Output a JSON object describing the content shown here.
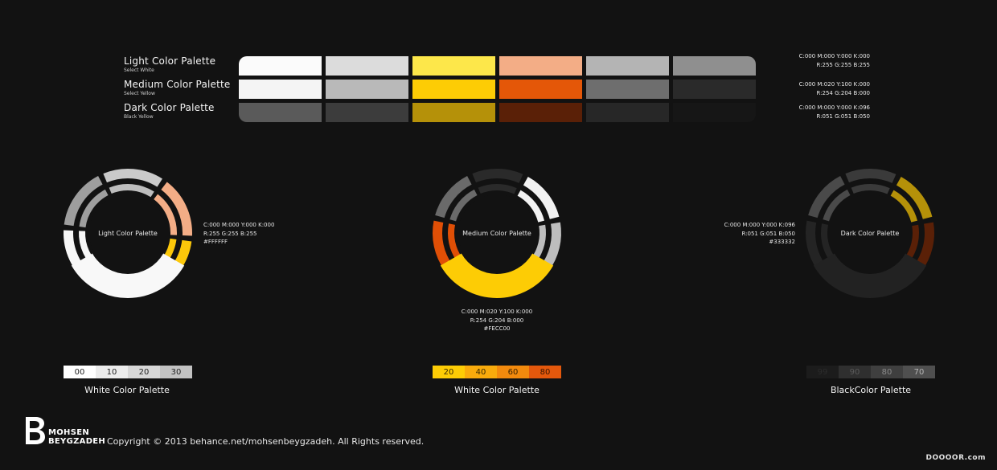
{
  "palettes": [
    {
      "title": "Light Color Palette",
      "subtitle": "Select White",
      "colors": [
        "#fbfbfb",
        "#dcdcdc",
        "#fde74a",
        "#f3ad86",
        "#b4b4b4",
        "#8f8f8f"
      ],
      "cmyk": "C:000  M:000  Y:000  K:000",
      "rgb": "R:255  G:255  B:255"
    },
    {
      "title": "Medium Color Palette",
      "subtitle": "Select Yellow",
      "colors": [
        "#f4f4f4",
        "#b9b9b9",
        "#fdcc05",
        "#e45708",
        "#6e6e6e",
        "#2a2a2a"
      ],
      "cmyk": "C:000  M:020  Y:100  K:000",
      "rgb": "R:254  G:204  B:000"
    },
    {
      "title": "Dark Color Palette",
      "subtitle": "Black Yellow",
      "colors": [
        "#5a5a5a",
        "#3c3c3c",
        "#b59109",
        "#5a2007",
        "#272727",
        "#161616"
      ],
      "cmyk": "C:000  M:000  Y:000  K:096",
      "rgb": "R:051  G:051  B:050"
    }
  ],
  "wheels": [
    {
      "label": "Light Color Palette",
      "info": [
        "C:000  M:000  Y:000  K:000",
        "R:255  G:255  B:255",
        "#FFFFFF"
      ],
      "outer_colors": [
        "#cacaca",
        "#f3ad86",
        "#fcc80a",
        "#f7f7f7",
        "#f7f7f7",
        "#9e9e9e"
      ],
      "inner_colors": [
        "#bdbdbd",
        "#f3ad86",
        "#fcc80a",
        "#f7f7f7",
        "#f7f7f7",
        "#9e9e9e"
      ]
    },
    {
      "label": "Medium Color Palette",
      "info": [
        "C:000  M:020  Y:100  K:000",
        "R:254  G:204  B:000",
        "#FECC00"
      ],
      "outer_colors": [
        "#2a2a2a",
        "#f2f2f2",
        "#bdbdbd",
        "#fdcc05",
        "#fdcc05",
        "#e04f06",
        "#6a6a6a"
      ],
      "inner_colors": [
        "#2a2a2a",
        "#f2f2f2",
        "#bdbdbd",
        "#fdcc05",
        "#fdcc05",
        "#e04f06",
        "#6a6a6a"
      ]
    },
    {
      "label": "Dark Color Palette",
      "info": [
        "C:000  M:000  Y:000  K:096",
        "R:051  G:051  B:050",
        "#333332"
      ],
      "outer_colors": [
        "#3a3a3a",
        "#b59109",
        "#5a2007",
        "#2a2a2a",
        "#242424",
        "#242424",
        "#4a4a4a"
      ],
      "inner_colors": [
        "#3a3a3a",
        "#b59109",
        "#5a2007",
        "#2a2a2a",
        "#242424",
        "#242424",
        "#4a4a4a"
      ]
    }
  ],
  "scales": [
    {
      "caption": "White Color Palette",
      "cells": [
        {
          "label": "00",
          "bg": "#ffffff",
          "fg": "#222222"
        },
        {
          "label": "10",
          "bg": "#ececec",
          "fg": "#222222"
        },
        {
          "label": "20",
          "bg": "#d7d7d7",
          "fg": "#222222"
        },
        {
          "label": "30",
          "bg": "#c2c2c2",
          "fg": "#222222"
        }
      ]
    },
    {
      "caption": "White Color Palette",
      "cells": [
        {
          "label": "20",
          "bg": "#fdcc05",
          "fg": "#3a2a00"
        },
        {
          "label": "40",
          "bg": "#f9ab0c",
          "fg": "#3a2a00"
        },
        {
          "label": "60",
          "bg": "#f38a0d",
          "fg": "#3a2200"
        },
        {
          "label": "80",
          "bg": "#e4580c",
          "fg": "#3a1500"
        }
      ]
    },
    {
      "caption": "BlackColor Palette",
      "cells": [
        {
          "label": "99",
          "bg": "#1c1c1c",
          "fg": "#2c2c2c"
        },
        {
          "label": "90",
          "bg": "#2f2f2f",
          "fg": "#5a5a5a"
        },
        {
          "label": "80",
          "bg": "#3f3f3f",
          "fg": "#8a8a8a"
        },
        {
          "label": "70",
          "bg": "#4f4f4f",
          "fg": "#b5b5b5"
        }
      ]
    }
  ],
  "footer": {
    "brand_line1": "MOHSEN",
    "brand_line2": "BEYGZADEH",
    "copyright": "Copyright © 2013 behance.net/mohsenbeygzadeh. All Rights reserved.",
    "watermark": "DOOOOR.com"
  }
}
